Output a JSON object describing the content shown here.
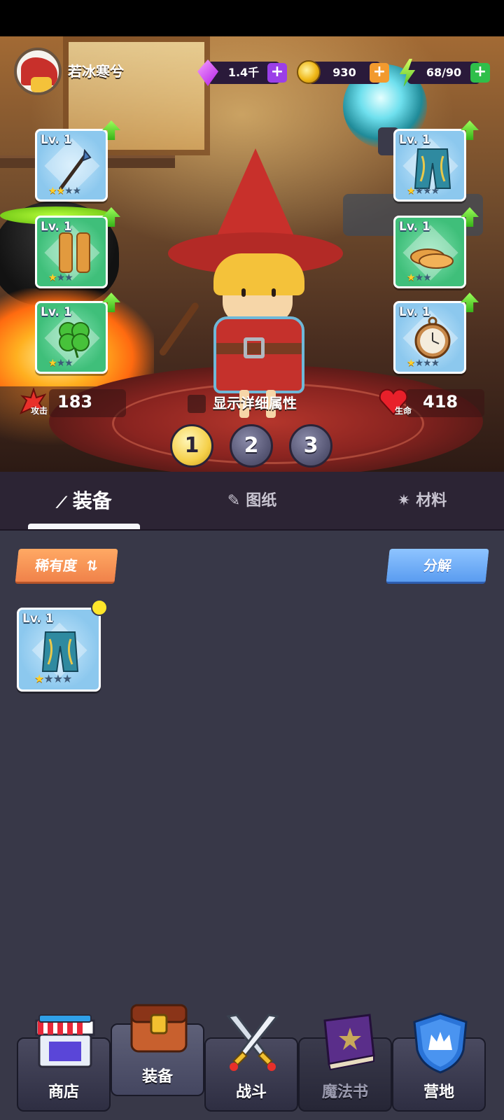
{
  "player": {
    "name": "若冰寒兮"
  },
  "resources": {
    "gems": "1.4千",
    "coins": "930",
    "energy": "68/90"
  },
  "colors": {
    "gem_plus": "#9b3fe8",
    "coin_plus": "#f29a2e",
    "energy_plus": "#2fbf4a",
    "accent_orange": "#f0824a",
    "accent_blue": "#5a9cf0"
  },
  "equipment_slots": {
    "left": [
      {
        "level": "Lv. 1",
        "item": "spear-icon",
        "stars_on": 2,
        "stars_total": 4,
        "upgradeable": true
      },
      {
        "level": "Lv. 1",
        "item": "leg-armor-icon",
        "stars_on": 1,
        "stars_total": 3,
        "upgradeable": true
      },
      {
        "level": "Lv. 1",
        "item": "clover-icon",
        "stars_on": 1,
        "stars_total": 3,
        "upgradeable": true
      }
    ],
    "right": [
      {
        "level": "Lv. 1",
        "item": "robe-pants-icon",
        "stars_on": 1,
        "stars_total": 4,
        "upgradeable": true
      },
      {
        "level": "Lv. 1",
        "item": "shoes-icon",
        "stars_on": 1,
        "stars_total": 3,
        "upgradeable": true
      },
      {
        "level": "Lv. 1",
        "item": "pocket-watch-icon",
        "stars_on": 1,
        "stars_total": 4,
        "upgradeable": true
      }
    ]
  },
  "stats": {
    "attack_label": "攻击",
    "attack_value": "183",
    "hp_label": "生命",
    "hp_value": "418",
    "detail_label": "显示详细属性"
  },
  "loadout_pages": [
    "1",
    "2",
    "3"
  ],
  "loadout_active": "1",
  "tabs": [
    {
      "label": "装备",
      "icon": "wand-icon",
      "active": true
    },
    {
      "label": "图纸",
      "icon": "scroll-icon",
      "active": false
    },
    {
      "label": "材料",
      "icon": "sparkle-icon",
      "active": false
    }
  ],
  "inventory": {
    "sort_label": "稀有度",
    "decompose_label": "分解",
    "items": [
      {
        "level": "Lv. 1",
        "item": "robe-pants-icon",
        "stars_on": 1,
        "stars_total": 4,
        "is_new": true
      }
    ]
  },
  "bottom_nav": [
    {
      "label": "商店",
      "icon": "shop-icon",
      "active": false
    },
    {
      "label": "装备",
      "icon": "backpack-icon",
      "active": true
    },
    {
      "label": "战斗",
      "icon": "crossed-swords-icon",
      "active": false
    },
    {
      "label": "魔法书",
      "icon": "spellbook-icon",
      "active": false,
      "dimmed": true
    },
    {
      "label": "营地",
      "icon": "crown-shield-icon",
      "active": false
    }
  ]
}
